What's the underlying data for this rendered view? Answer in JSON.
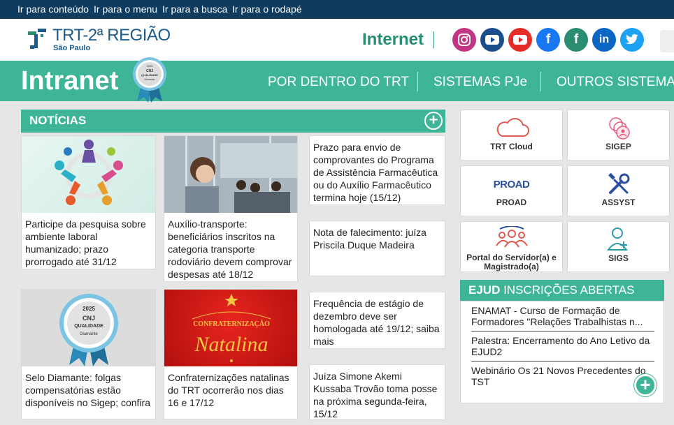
{
  "skip_links": [
    "Ir para conteúdo",
    "Ir para o menu",
    "Ir para a busca",
    "Ir para o rodapé"
  ],
  "header": {
    "logo_title": "TRT-2ª REGIÃO",
    "logo_subtitle": "São Paulo",
    "internet_label": "Internet",
    "social_icons": [
      "instagram-icon",
      "youtube-icon",
      "youtube-icon",
      "facebook-icon",
      "facebook-icon",
      "linkedin-icon",
      "twitter-icon"
    ],
    "social_colors": [
      "#c13584",
      "#1b4d8c",
      "#e52d27",
      "#1877f2",
      "#2a8c70",
      "#0a66c2",
      "#1da1f2"
    ]
  },
  "nav": {
    "title": "Intranet",
    "medal_text": [
      "2025",
      "CNJ",
      "QUALIDADE",
      "Diamante"
    ],
    "items": [
      "POR DENTRO DO TRT",
      "SISTEMAS PJe",
      "OUTROS SISTEMAS"
    ]
  },
  "news": {
    "heading": "NOTÍCIAS",
    "image_cards": [
      {
        "text": "Participe da pesquisa sobre ambiente laboral humanizado; prazo prorrogado até 31/12"
      },
      {
        "text": "Auxílio-transporte: beneficiários inscritos na categoria transporte rodoviário devem comprovar despesas até 18/12"
      },
      {
        "text": "Selo Diamante: folgas compensatórias estão disponíveis no Sigep; confira",
        "badge_text": [
          "2025",
          "CNJ",
          "QUALIDADE",
          "Diamante"
        ]
      },
      {
        "text": "Confraternizações natalinas do TRT ocorrerão nos dias 16 e 17/12",
        "banner_top": "CONFRATERNIZAÇÃO",
        "banner_bottom": "Natalina"
      }
    ],
    "text_cards": [
      "Prazo para envio de comprovantes do Programa de Assistência Farmacêutica ou do Auxílio Farmacêutico termina hoje (15/12)",
      "Nota de falecimento: juíza Priscila Duque Madeira",
      "Frequência de estágio de dezembro deve ser homologada até 19/12; saiba mais",
      "Juíza Simone Akemi Kussaba Trovão toma posse na próxima segunda-feira, 15/12"
    ]
  },
  "systems": [
    {
      "label": "TRT Cloud",
      "icon": "cloud-icon"
    },
    {
      "label": "SIGEP",
      "icon": "people-circle-icon"
    },
    {
      "label": "PROAD",
      "icon": "proad-logo",
      "logo_text": "PROAD"
    },
    {
      "label": "ASSYST",
      "icon": "tools-icon"
    },
    {
      "label": "Portal do Servidor(a) e Magistrado(a)",
      "icon": "group-icon"
    },
    {
      "label": "SIGS",
      "icon": "health-user-icon"
    }
  ],
  "ejud": {
    "heading_bold": "EJUD",
    "heading_rest": " INSCRIÇÕES ABERTAS",
    "items": [
      "ENAMAT - Curso de Formação de Formadores \"Relações Trabalhistas n...",
      "Palestra: Encerramento do Ano Letivo da EJUD2",
      "Webinário Os 21 Novos Precedentes do TST"
    ]
  },
  "colors": {
    "primary_green": "#3fb597",
    "top_bar": "#0e3b5e",
    "logo_blue": "#1b5c8c"
  }
}
